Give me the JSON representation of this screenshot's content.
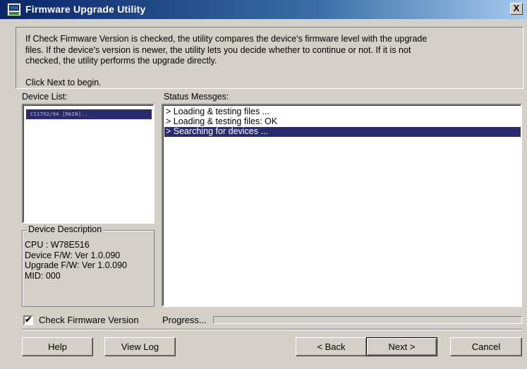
{
  "window": {
    "title": "Firmware Upgrade Utility",
    "close_glyph": "X"
  },
  "info": {
    "line1": "If Check Firmware Version is checked, the utility compares the device's firmware level with the upgrade",
    "line2": "files. If the device's version is newer, the utility lets you decide whether to continue or not. If it is not",
    "line3": "checked, the utility performs the upgrade directly.",
    "click_next": "Click Next to begin."
  },
  "device_list": {
    "label": "Device List:",
    "items": [
      {
        "label": "CS1792/94 [MAIN]..",
        "selected": true
      }
    ]
  },
  "device_description": {
    "title": "Device Description",
    "cpu": "CPU : W78E516",
    "device_fw": "Device F/W: Ver 1.0.090",
    "upgrade_fw": "Upgrade F/W: Ver 1.0.090",
    "mid": "MID: 000"
  },
  "status": {
    "label": "Status Messges:",
    "lines": [
      {
        "text": "> Loading & testing files ...",
        "selected": false
      },
      {
        "text": "> Loading & testing files: OK",
        "selected": false
      },
      {
        "text": "> Searching for devices ...",
        "selected": true
      }
    ]
  },
  "check_firmware": {
    "label": "Check Firmware Version",
    "checked": true,
    "check_glyph": "✔"
  },
  "progress": {
    "label": "Progress...",
    "value": 0
  },
  "buttons": {
    "help": "Help",
    "view_log": "View Log",
    "back": "< Back",
    "next": "Next >",
    "cancel": "Cancel"
  },
  "colors": {
    "title_bar": "#0a246a",
    "selection": "#2a2a6e",
    "face": "#d4d0c8"
  }
}
